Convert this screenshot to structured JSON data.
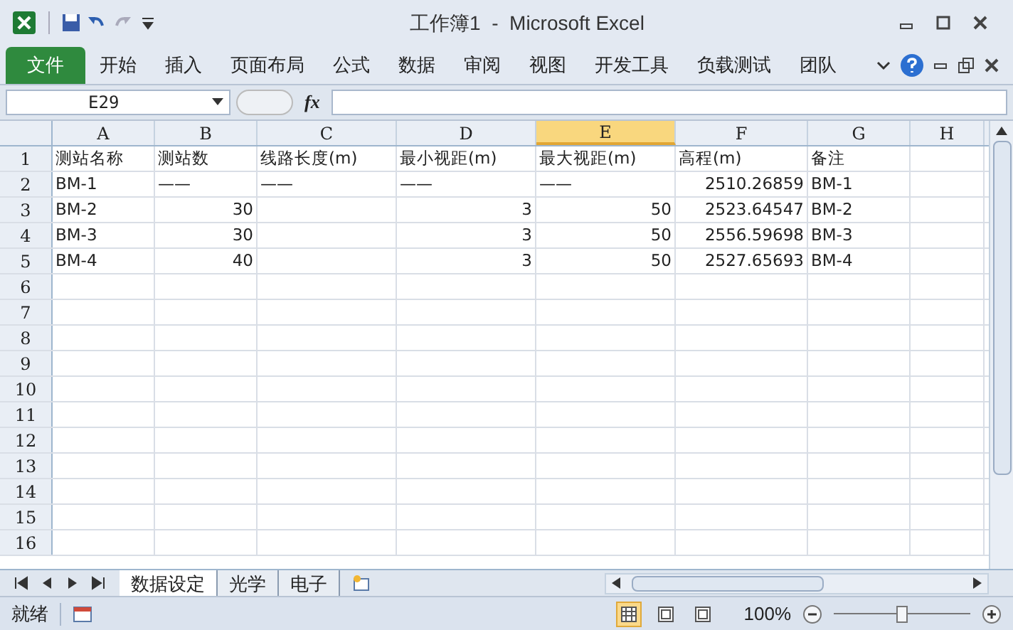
{
  "window": {
    "title": "工作簿1  -  Microsoft Excel"
  },
  "ribbon": {
    "file_tab": "文件",
    "tabs": [
      "开始",
      "插入",
      "页面布局",
      "公式",
      "数据",
      "审阅",
      "视图",
      "开发工具",
      "负载测试",
      "团队"
    ]
  },
  "formula_bar": {
    "name_box": "E29",
    "fx": "fx"
  },
  "columns": [
    {
      "label": "A",
      "selected": false
    },
    {
      "label": "B",
      "selected": false
    },
    {
      "label": "C",
      "selected": false
    },
    {
      "label": "D",
      "selected": false
    },
    {
      "label": "E",
      "selected": true
    },
    {
      "label": "F",
      "selected": false
    },
    {
      "label": "G",
      "selected": false
    },
    {
      "label": "H",
      "selected": false
    }
  ],
  "rows": [
    {
      "label": "1",
      "cells": [
        {
          "text": "测站名称"
        },
        {
          "text": "测站数"
        },
        {
          "text": "线路长度(m)"
        },
        {
          "text": "最小视距(m)"
        },
        {
          "text": "最大视距(m)"
        },
        {
          "text": "高程(m)"
        },
        {
          "text": "备注"
        }
      ]
    },
    {
      "label": "2",
      "cells": [
        {
          "text": "BM-1"
        },
        {
          "text": "——"
        },
        {
          "text": "——"
        },
        {
          "text": "——"
        },
        {
          "text": "——"
        },
        {
          "text": "2510.26859",
          "kind": "number"
        },
        {
          "text": "BM-1"
        }
      ]
    },
    {
      "label": "3",
      "cells": [
        {
          "text": "BM-2"
        },
        {
          "text": "30",
          "kind": "number"
        },
        null,
        {
          "text": "3",
          "kind": "number"
        },
        {
          "text": "50",
          "kind": "number"
        },
        {
          "text": "2523.64547",
          "kind": "number"
        },
        {
          "text": "BM-2"
        }
      ]
    },
    {
      "label": "4",
      "cells": [
        {
          "text": "BM-3"
        },
        {
          "text": "30",
          "kind": "number"
        },
        null,
        {
          "text": "3",
          "kind": "number"
        },
        {
          "text": "50",
          "kind": "number"
        },
        {
          "text": "2556.59698",
          "kind": "number"
        },
        {
          "text": "BM-3"
        }
      ]
    },
    {
      "label": "5",
      "cells": [
        {
          "text": "BM-4"
        },
        {
          "text": "40",
          "kind": "number"
        },
        null,
        {
          "text": "3",
          "kind": "number"
        },
        {
          "text": "50",
          "kind": "number"
        },
        {
          "text": "2527.65693",
          "kind": "number"
        },
        {
          "text": "BM-4"
        }
      ]
    },
    {
      "label": "6",
      "cells": []
    },
    {
      "label": "7",
      "cells": []
    },
    {
      "label": "8",
      "cells": []
    },
    {
      "label": "9",
      "cells": []
    },
    {
      "label": "10",
      "cells": []
    },
    {
      "label": "11",
      "cells": []
    },
    {
      "label": "12",
      "cells": []
    },
    {
      "label": "13",
      "cells": []
    },
    {
      "label": "14",
      "cells": []
    },
    {
      "label": "15",
      "cells": []
    },
    {
      "label": "16",
      "cells": []
    }
  ],
  "sheet_tabs": [
    {
      "label": "数据设定",
      "selected": true
    },
    {
      "label": "光学",
      "selected": false
    },
    {
      "label": "电子",
      "selected": false
    }
  ],
  "status_bar": {
    "status": "就绪",
    "views": [
      {
        "selected": true
      },
      {
        "selected": false
      },
      {
        "selected": false
      }
    ],
    "zoom": "100%",
    "zoom_level": {
      "level": 0.5
    }
  }
}
